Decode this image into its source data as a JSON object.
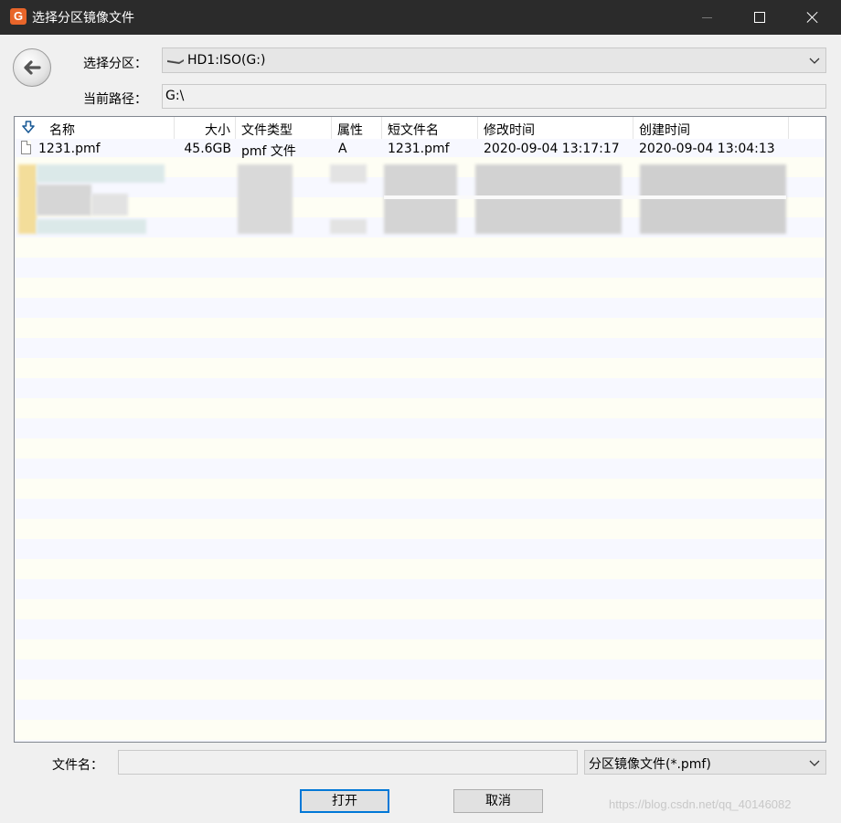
{
  "window": {
    "title": "选择分区镜像文件",
    "app_icon_letter": "G"
  },
  "form": {
    "partition_label": "选择分区：",
    "partition_value": "HD1:ISO(G:)",
    "path_label": "当前路径：",
    "path_value": "G:\\"
  },
  "file_list": {
    "columns": [
      "名称",
      "大小",
      "文件类型",
      "属性",
      "短文件名",
      "修改时间",
      "创建时间"
    ],
    "rows": [
      {
        "name": "1231.pmf",
        "size": "45.6GB",
        "type": "pmf 文件",
        "attr": "A",
        "short_name": "1231.pmf",
        "modified": "2020-09-04 13:17:17",
        "created": "2020-09-04 13:04:13"
      }
    ]
  },
  "bottom": {
    "filename_label": "文件名：",
    "filename_value": "",
    "filter_value": "分区镜像文件(*.pmf)",
    "open_label": "打开",
    "cancel_label": "取消"
  },
  "watermark": "https://blog.csdn.net/qq_40146082",
  "colors": {
    "titlebar": "#2b2b2b",
    "accent": "#0078d7",
    "app_icon": "#e8652a"
  }
}
